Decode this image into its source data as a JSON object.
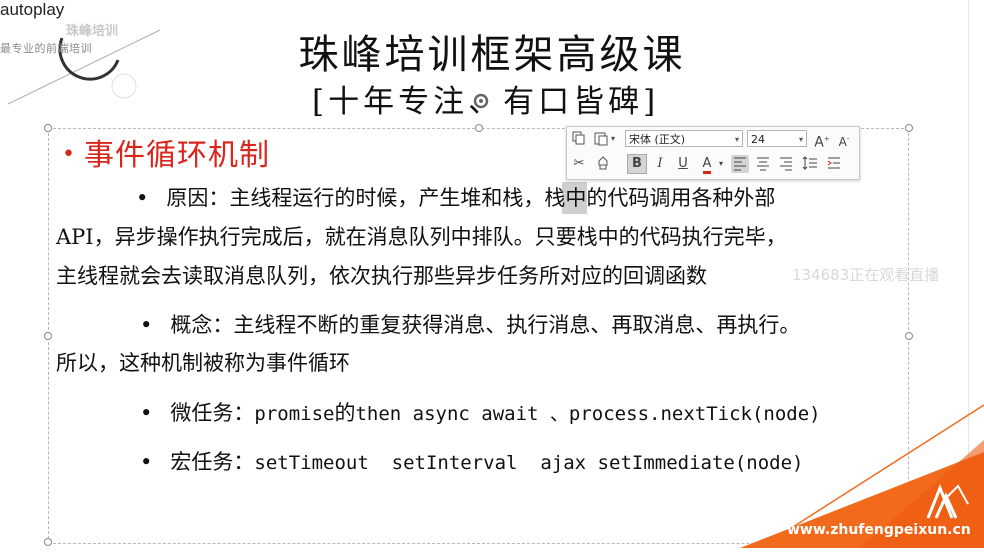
{
  "logo": {
    "autoplay": "autoplay",
    "brand_cn": "珠峰培训",
    "tagline": "最专业的前端培训"
  },
  "slide": {
    "title": "珠峰培训框架高级课",
    "subtitle": "[十年专注、有口皆碑]",
    "heading": "事件循环机制",
    "paragraphs": {
      "reason_l1_a": "原因：主线程运行的时候，产生堆和",
      "reason_l1_b": "栈",
      "reason_l1_c": "，栈中的代码调用各种外部",
      "reason_l2": "API，异步操作执行完成后，就在消息队列中排队。只要栈中的代码执行完毕，",
      "reason_l3": "主线程就会去读取消息队列，依次执行那些异步任务所对应的回调函数",
      "concept_l1": "概念：主线程不断的重复获得消息、执行消息、再取消息、再执行。",
      "concept_l2": "所以，这种机制被称为事件循环",
      "micro_label": "微任务：",
      "micro_a": "promise",
      "micro_b": "的",
      "micro_c": "then async await 、process.nextTick(node)",
      "macro_label": "宏任务：",
      "macro_a": "setTimeout  setInterval  ajax setImmediate(node)"
    },
    "bullet": "•"
  },
  "toolbar": {
    "font_name": "宋体 (正文)",
    "font_size": "24",
    "bold": "B",
    "italic": "I",
    "underline": "U",
    "font_color": "A"
  },
  "watermark": "134683正在观看直播",
  "footer": {
    "url": "www.zhufengpeixun.cn"
  },
  "colors": {
    "accent_red": "#d9261c",
    "orange": "#f26a1b",
    "highlight": "#cfcfcf"
  }
}
